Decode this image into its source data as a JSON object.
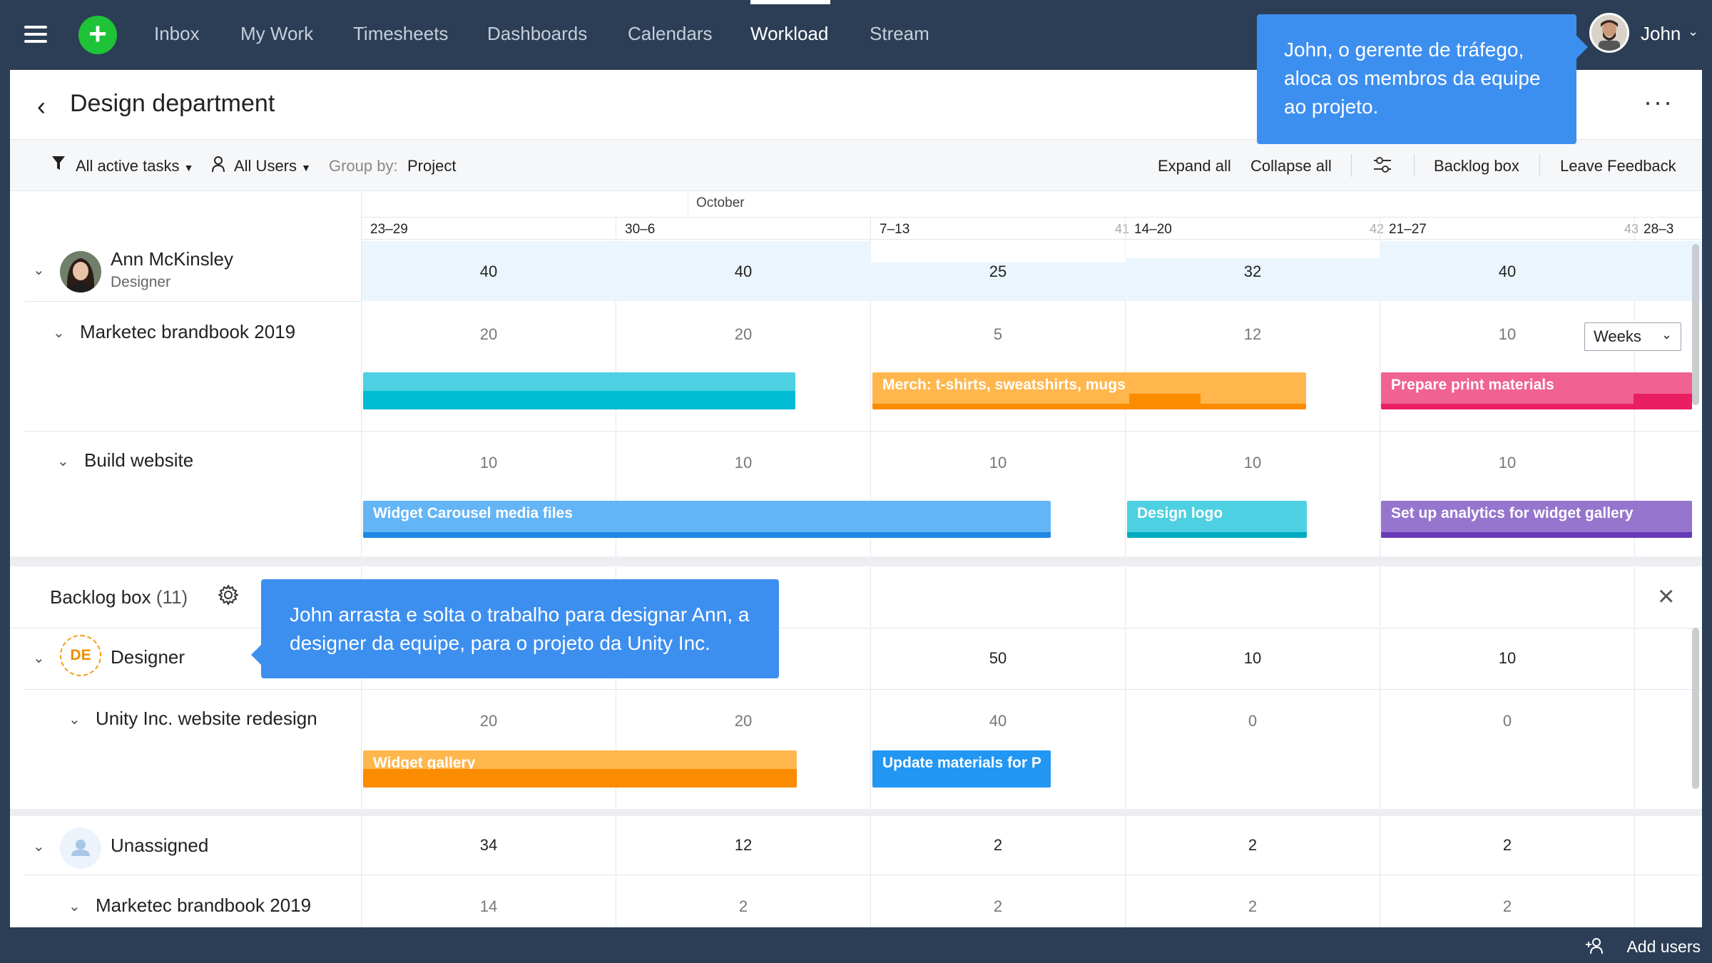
{
  "nav": {
    "items": [
      "Inbox",
      "My Work",
      "Timesheets",
      "Dashboards",
      "Calendars",
      "Workload",
      "Stream"
    ],
    "active": "Workload",
    "user": "John"
  },
  "callouts": {
    "top": "John, o gerente de tráfego, aloca os membros da equipe ao projeto.",
    "backlog": "John arrasta e solta o trabalho para designar Ann, a designer da equipe, para o projeto da Unity Inc."
  },
  "header": {
    "title": "Design department"
  },
  "toolbar": {
    "filter": "All active tasks",
    "users": "All Users",
    "group_by_label": "Group by:",
    "group_by_value": "Project",
    "expand_all": "Expand all",
    "collapse_all": "Collapse all",
    "backlog_box": "Backlog box",
    "leave_feedback": "Leave Feedback"
  },
  "calendar": {
    "month": "October",
    "weeks": [
      "23–29",
      "30–6",
      "7–13",
      "14–20",
      "21–27",
      "28–3"
    ],
    "week_numbers": [
      "",
      "",
      "41",
      "42",
      "43",
      ""
    ],
    "scale": "Weeks"
  },
  "rows": {
    "ann": {
      "name": "Ann McKinsley",
      "role": "Designer",
      "totals": [
        "40",
        "40",
        "25",
        "32",
        "40"
      ],
      "projects": [
        {
          "name": "Marketec brandbook 2019",
          "hours": [
            "20",
            "20",
            "5",
            "12",
            "10"
          ],
          "tasks": [
            "",
            "Merch: t-shirts, sweatshirts, mugs",
            "Prepare print materials"
          ]
        },
        {
          "name": "Build website",
          "hours": [
            "10",
            "10",
            "10",
            "10",
            "10"
          ],
          "tasks": [
            "Widget Carousel media files",
            "Design logo",
            "Set up analytics for widget gallery"
          ]
        }
      ]
    },
    "backlog": {
      "title": "Backlog box",
      "count": "(11)",
      "designer": {
        "badge": "DE",
        "name": "Designer",
        "totals": [
          "50",
          "10",
          "10"
        ],
        "project": {
          "name": "Unity Inc. website redesign",
          "hours": [
            "20",
            "20",
            "40",
            "0",
            "0"
          ],
          "tasks": [
            "Widget gallery",
            "Update materials for P"
          ]
        }
      },
      "unassigned": {
        "name": "Unassigned",
        "totals": [
          "34",
          "12",
          "2",
          "2",
          "2"
        ],
        "project": {
          "name": "Marketec brandbook 2019",
          "hours": [
            "14",
            "2",
            "2",
            "2",
            "2"
          ]
        }
      }
    }
  },
  "footer": {
    "add_users": "Add users"
  },
  "colors": {
    "nav_bg": "#2c3e55",
    "callout": "#3d8fef",
    "cyan_bar": "#4dd0e1",
    "orange_bar": "#ffb74d",
    "pink_bar": "#f06292",
    "blue_bar": "#64b5f6",
    "purple_bar": "#9575cd",
    "update_bar": "#2196f3"
  }
}
